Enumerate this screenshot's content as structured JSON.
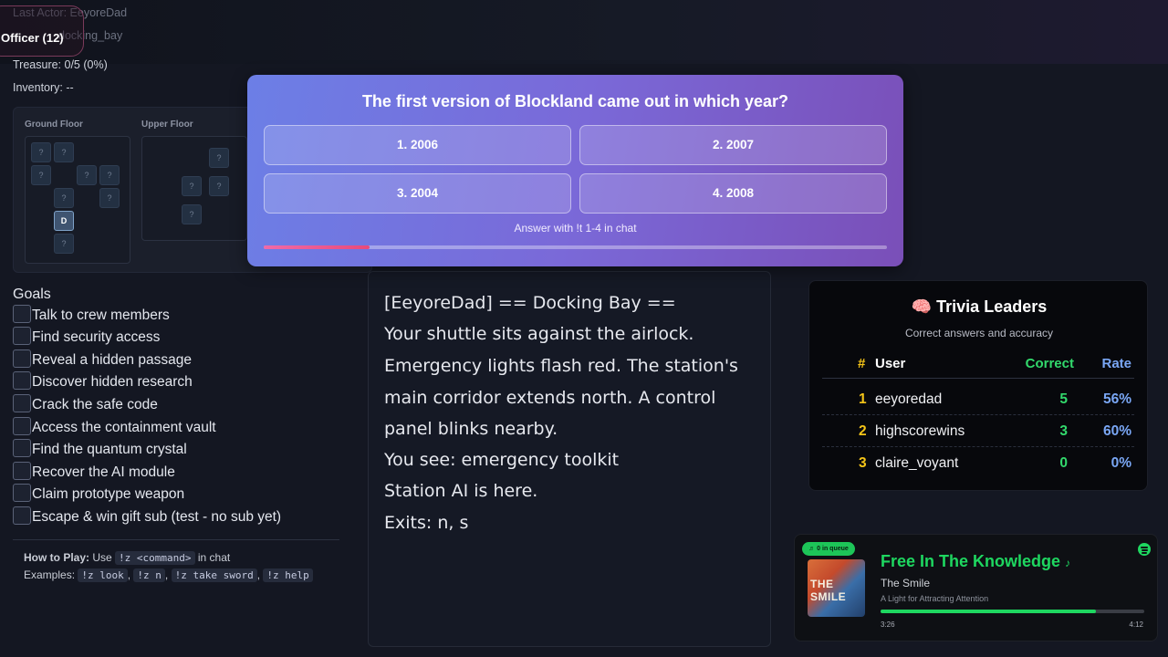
{
  "status": {
    "last_actor_label": "Last Actor:",
    "last_actor": "EeyoreDad",
    "room_line": "docking_bay",
    "officer_badge": "Officer (12)",
    "treasure": "Treasure: 0/5 (0%)",
    "inventory": "Inventory: --"
  },
  "map": {
    "ground_label": "Ground Floor",
    "upper_label": "Upper Floor",
    "unknown_glyph": "?",
    "current_glyph": "D"
  },
  "goals": {
    "title": "Goals",
    "items": [
      "Talk to crew members",
      "Find security access",
      "Reveal a hidden passage",
      "Discover hidden research",
      "Crack the safe code",
      "Access the containment vault",
      "Find the quantum crystal",
      "Recover the AI module",
      "Claim prototype weapon",
      "Escape & win gift sub (test - no sub yet)"
    ]
  },
  "howto": {
    "label": "How to Play:",
    "use": "Use",
    "command": "!z <command>",
    "in_chat": "in chat",
    "examples_label": "Examples:",
    "examples": [
      "!z look",
      "!z n",
      "!z take sword",
      "!z help"
    ],
    "comma": ","
  },
  "trivia_question": {
    "question": "The first version of Blockland came out in which year?",
    "options": [
      "1. 2006",
      "2. 2007",
      "3. 2004",
      "4. 2008"
    ],
    "hint": "Answer with !t 1-4 in chat",
    "time_progress": 0.17
  },
  "story": {
    "lines": [
      "[EeyoreDad] == Docking Bay ==",
      "Your shuttle sits against the airlock.",
      "Emergency lights flash red. The station's",
      "main corridor extends north. A control",
      "panel blinks nearby.",
      "You see: emergency toolkit",
      "Station AI is here.",
      "Exits: n, s"
    ]
  },
  "leaders": {
    "icon": "brain-icon",
    "title": "🧠 Trivia Leaders",
    "subtitle": "Correct answers and accuracy",
    "headers": {
      "rank": "#",
      "user": "User",
      "correct": "Correct",
      "rate": "Rate"
    },
    "rows": [
      {
        "rank": "1",
        "user": "eeyoredad",
        "correct": "5",
        "rate": "56%"
      },
      {
        "rank": "2",
        "user": "highscorewins",
        "correct": "3",
        "rate": "60%"
      },
      {
        "rank": "3",
        "user": "claire_voyant",
        "correct": "0",
        "rate": "0%"
      }
    ],
    "colors": {
      "rank": "#f5c518",
      "correct": "#32d96c",
      "rate": "#7aa7f5"
    }
  },
  "music": {
    "queue": "♬ 0 in queue",
    "cover_text": "THE SMILE",
    "title": "Free In The Knowledge",
    "note": "♪",
    "artist": "The Smile",
    "album": "A Light for Attracting Attention",
    "elapsed": "3:26",
    "duration": "4:12",
    "progress": 0.815,
    "accent": "#1ed760",
    "service_icon": "spotify-icon"
  }
}
